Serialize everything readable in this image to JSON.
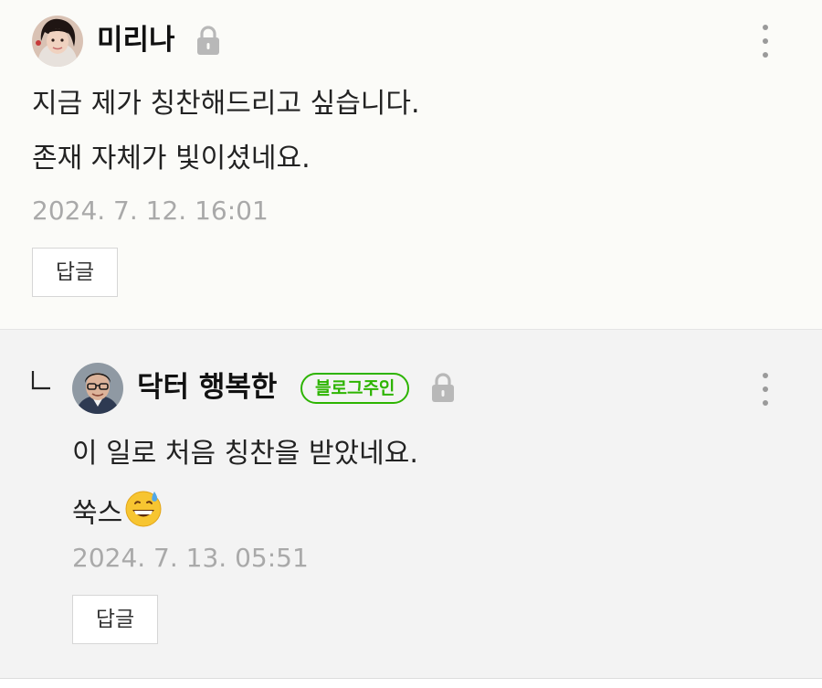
{
  "comments": [
    {
      "author": "미리나",
      "lines": [
        "지금 제가 칭찬해드리고 싶습니다.",
        "존재 자체가 빛이셨네요."
      ],
      "date": "2024. 7. 12. 16:01",
      "reply_label": "답글",
      "avatar_icon": "user-photo-avatar",
      "lock_icon": "lock-icon",
      "more_icon": "more-vertical-icon"
    },
    {
      "author": "닥터 행복한",
      "badge": "블로그주인",
      "lines": [
        "이 일로 처음 칭찬을 받았네요.",
        "쑥스"
      ],
      "emoji": "grinning-sweat-emoji",
      "date": "2024. 7. 13. 05:51",
      "reply_label": "답글",
      "avatar_icon": "user-photo-avatar",
      "lock_icon": "lock-icon",
      "more_icon": "more-vertical-icon",
      "reply_indent_icon": "reply-arrow-icon"
    }
  ],
  "colors": {
    "badge_green": "#2db400",
    "date_gray": "#a9a9a9",
    "reply_bg": "#f3f3f3"
  }
}
